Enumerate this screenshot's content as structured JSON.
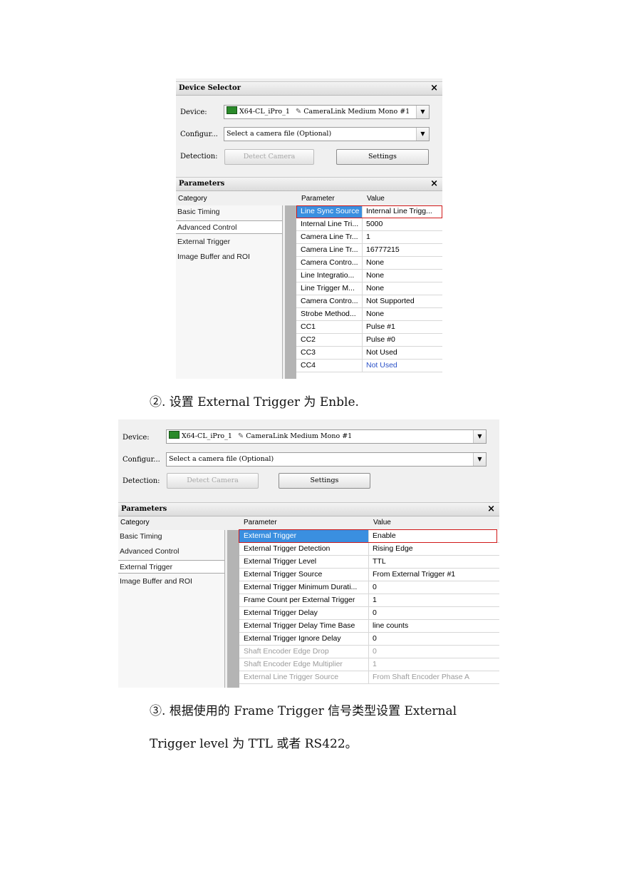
{
  "screenshot1": {
    "device_selector": {
      "title": "Device Selector",
      "close": "×",
      "device_label": "Device:",
      "device_board": "X64-CL_iPro_1",
      "device_camera": "CameraLink Medium Mono #1",
      "config_label": "Configur...",
      "config_value": "Select a camera file (Optional)",
      "detection_label": "Detection:",
      "detect_button": "Detect Camera",
      "settings_button": "Settings"
    },
    "parameters": {
      "title": "Parameters",
      "close": "×",
      "category_header": "Category",
      "parameter_header": "Parameter",
      "value_header": "Value",
      "categories": [
        "Basic Timing",
        "Advanced Control",
        "External Trigger",
        "Image Buffer and ROI"
      ],
      "rows": [
        {
          "param": "Line Sync Source",
          "value": "Internal Line Trigg..."
        },
        {
          "param": "Internal Line Tri...",
          "value": "5000"
        },
        {
          "param": "Camera Line Tr...",
          "value": "1"
        },
        {
          "param": "Camera Line Tr...",
          "value": "16777215"
        },
        {
          "param": "Camera Contro...",
          "value": "None"
        },
        {
          "param": "Line Integratio...",
          "value": "None"
        },
        {
          "param": "Line Trigger M...",
          "value": "None"
        },
        {
          "param": "Camera Contro...",
          "value": "Not Supported"
        },
        {
          "param": "Strobe Method...",
          "value": "None"
        },
        {
          "param": "CC1",
          "value": "Pulse #1"
        },
        {
          "param": "CC2",
          "value": "Pulse #0"
        },
        {
          "param": "CC3",
          "value": "Not Used"
        },
        {
          "param": "CC4",
          "value": "Not Used"
        }
      ]
    }
  },
  "step2_text": "②. 设置 External Trigger 为 Enble.",
  "screenshot2": {
    "device_selector": {
      "device_label": "Device:",
      "device_board": "X64-CL_iPro_1",
      "device_camera": "CameraLink Medium Mono #1",
      "config_label": "Configur...",
      "config_value": "Select a camera file (Optional)",
      "detection_label": "Detection:",
      "detect_button": "Detect Camera",
      "settings_button": "Settings"
    },
    "parameters": {
      "title": "Parameters",
      "close": "×",
      "category_header": "Category",
      "parameter_header": "Parameter",
      "value_header": "Value",
      "categories": [
        "Basic Timing",
        "Advanced Control",
        "External Trigger",
        "Image Buffer and ROI"
      ],
      "rows": [
        {
          "param": "External Trigger",
          "value": "Enable"
        },
        {
          "param": "External Trigger Detection",
          "value": "Rising Edge"
        },
        {
          "param": "External Trigger Level",
          "value": "TTL"
        },
        {
          "param": "External Trigger Source",
          "value": "From External Trigger #1"
        },
        {
          "param": "External Trigger Minimum Durati...",
          "value": "0"
        },
        {
          "param": "Frame Count per External Trigger",
          "value": "1"
        },
        {
          "param": "External Trigger Delay",
          "value": "0"
        },
        {
          "param": "External Trigger Delay Time Base",
          "value": "line counts"
        },
        {
          "param": "External Trigger Ignore Delay",
          "value": "0"
        },
        {
          "param": "Shaft Encoder Edge Drop",
          "value": "0"
        },
        {
          "param": "Shaft Encoder Edge Multiplier",
          "value": "1"
        },
        {
          "param": "External Line Trigger Source",
          "value": "From Shaft Encoder Phase A"
        }
      ]
    }
  },
  "step3_line1": "③. 根据使用的 Frame Trigger 信号类型设置 External",
  "step3_line2": "Trigger level 为 TTL 或者 RS422。"
}
